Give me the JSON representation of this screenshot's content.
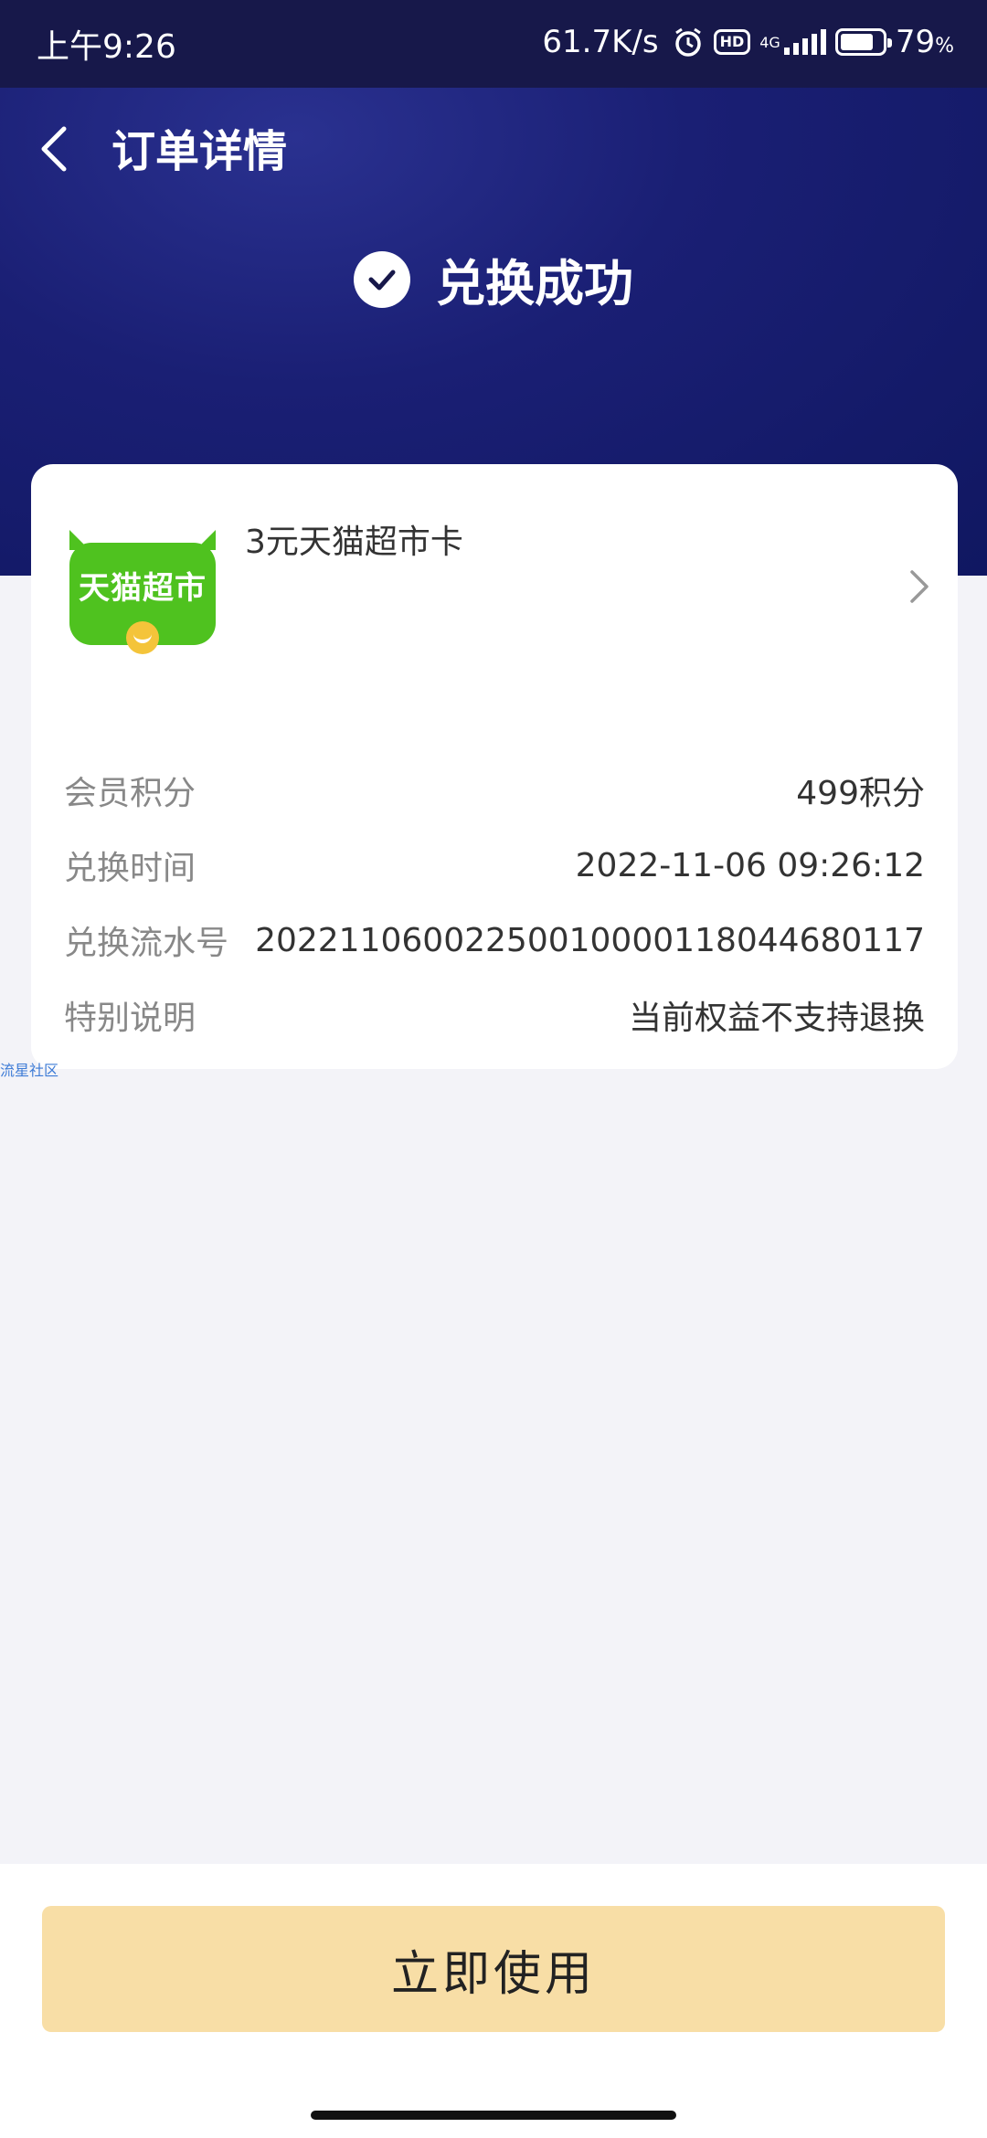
{
  "status_bar": {
    "time": "上午9:26",
    "net_speed": "61.7K/s",
    "hd": "HD",
    "net_type": "4G",
    "battery": "79",
    "battery_unit": "%",
    "battery_level": 0.79
  },
  "header": {
    "title": "订单详情",
    "status_text": "兑换成功"
  },
  "product": {
    "logo_text": "天猫超市",
    "name": "3元天猫超市卡"
  },
  "details": [
    {
      "label": "会员积分",
      "value": "499积分"
    },
    {
      "label": "兑换时间",
      "value": "2022-11-06 09:26:12"
    },
    {
      "label": "兑换流水号",
      "value": "20221106002250010000118044680117"
    },
    {
      "label": "特别说明",
      "value": "当前权益不支持退换"
    }
  ],
  "watermark": "流星社区",
  "action_button": "立即使用",
  "colors": {
    "hero_bg": "#1a1f74",
    "button_bg": "#f8dea6",
    "logo_green": "#4fc21f"
  }
}
